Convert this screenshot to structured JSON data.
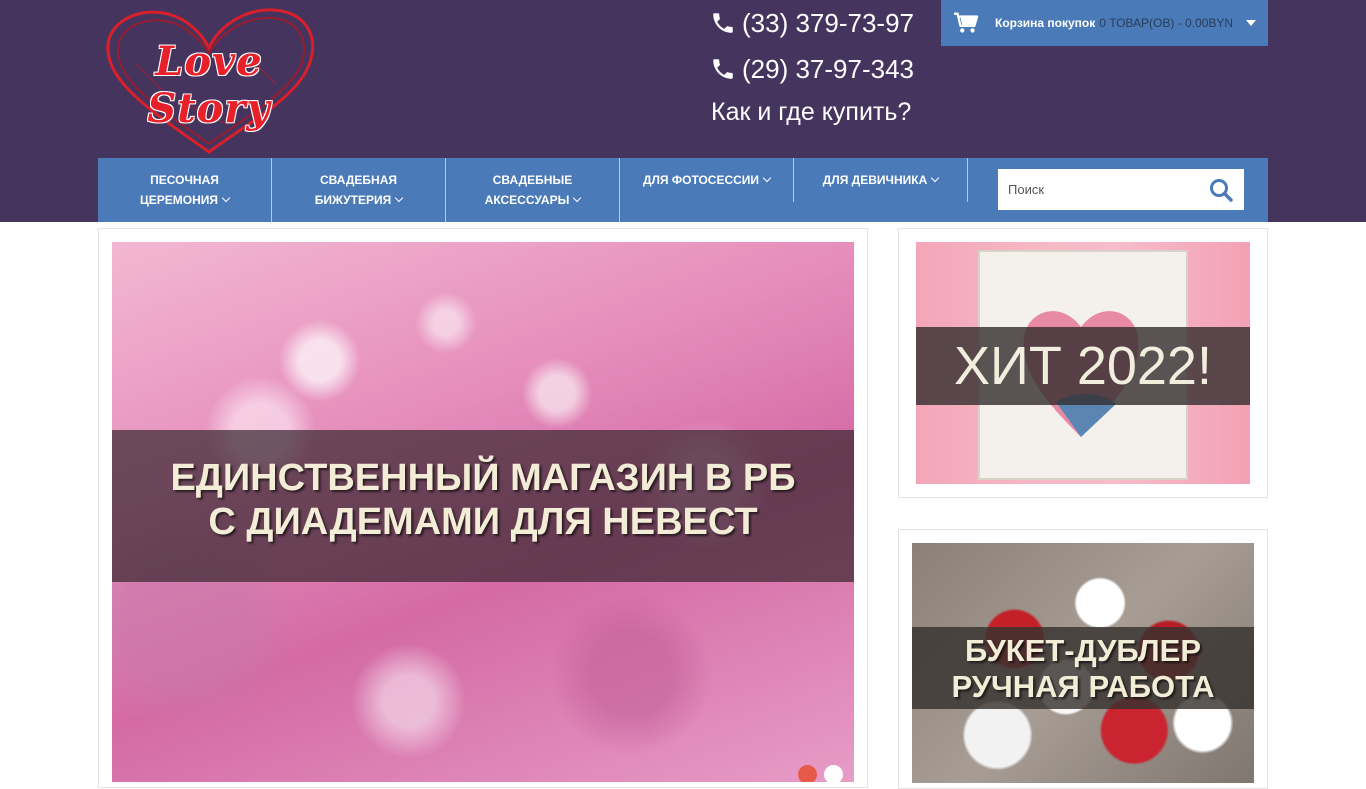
{
  "brand": {
    "logo_text": "Love Story"
  },
  "contacts": {
    "phone_1": "(33) 379-73-97",
    "phone_2": "(29) 37-97-343",
    "how_to_buy": "Как и где купить?"
  },
  "cart": {
    "title": "Корзина покупок",
    "summary": "0 ТОВАР(ОВ) - 0.00BYN"
  },
  "nav": {
    "items": [
      {
        "line1": "ПЕСОЧНАЯ",
        "line2": "ЦЕРЕМОНИЯ"
      },
      {
        "line1": "СВАДЕБНАЯ",
        "line2": "БИЖУТЕРИЯ"
      },
      {
        "line1": "СВАДЕБНЫЕ",
        "line2": "АКСЕССУАРЫ"
      },
      {
        "line1": "ДЛЯ ФОТОСЕССИИ",
        "line2": ""
      },
      {
        "line1": "ДЛЯ ДЕВИЧНИКА",
        "line2": ""
      }
    ]
  },
  "search": {
    "placeholder": "Поиск"
  },
  "slider": {
    "caption_line1": "ЕДИНСТВЕННЫЙ МАГАЗИН В РБ",
    "caption_line2": "С ДИАДЕМАМИ ДЛЯ НЕВЕСТ",
    "dots": 2,
    "active_dot": 1
  },
  "promos": {
    "promo_1": {
      "caption": "ХИТ 2022!"
    },
    "promo_2": {
      "caption_line1": "БУКЕТ-ДУБЛЕР",
      "caption_line2": "РУЧНАЯ РАБОТА"
    }
  },
  "colors": {
    "header_bg": "#45345d",
    "nav_bg": "#4a7ab7",
    "logo_red": "#e8202a",
    "active_dot": "#e65a4a"
  },
  "icons": [
    "phone-icon",
    "cart-icon",
    "chevron-down-icon",
    "search-icon"
  ]
}
